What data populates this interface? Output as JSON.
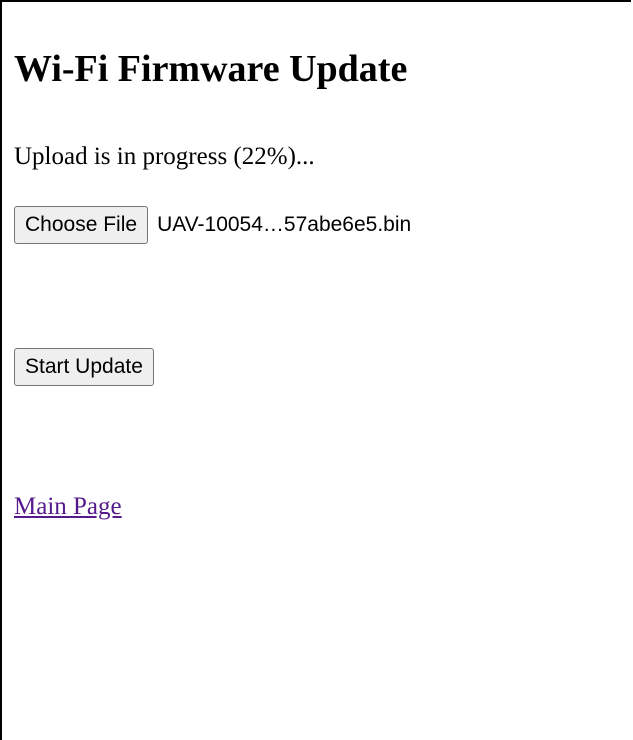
{
  "page": {
    "title": "Wi-Fi Firmware Update",
    "status_text": "Upload is in progress (22%)...",
    "upload_progress_percent": 22
  },
  "file_input": {
    "button_label": "Choose File",
    "file_name": "UAV-10054…57abe6e5.bin"
  },
  "actions": {
    "start_update_label": "Start Update"
  },
  "links": {
    "main_page_label": "Main Page",
    "link_color": "#551a8b"
  }
}
